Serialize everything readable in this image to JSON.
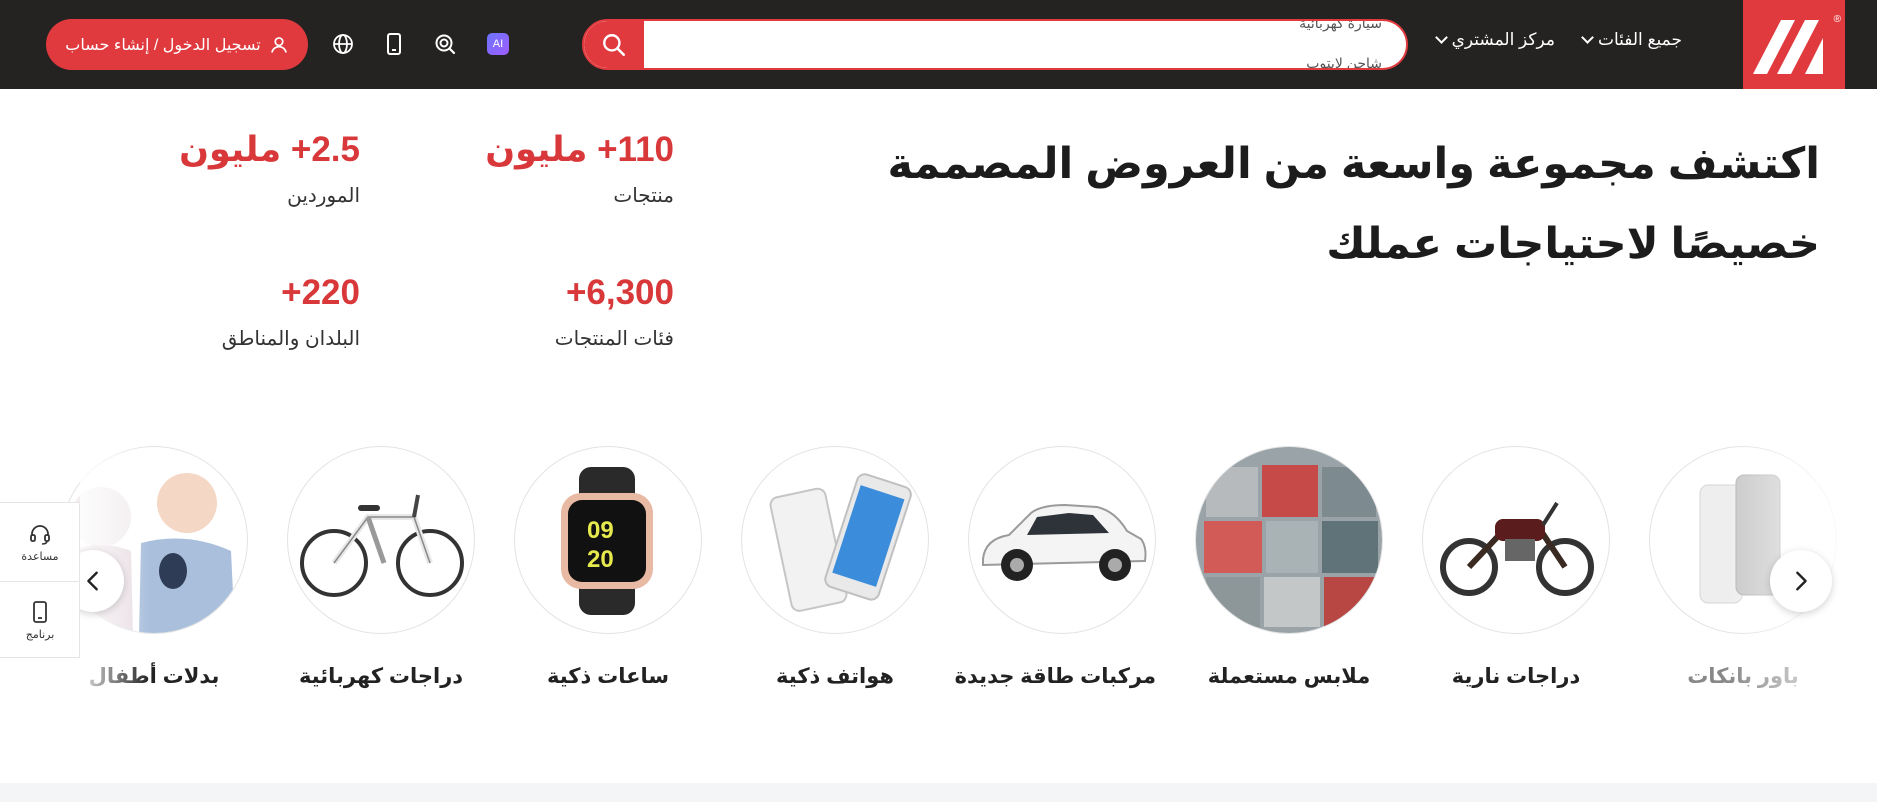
{
  "header": {
    "logo_alt": "M",
    "registered_mark": "®",
    "nav_all_categories": "جميع الفئات",
    "nav_buyer_center": "مركز المشتري",
    "search_rotating": [
      "سيارة كهربائية",
      "شاحن لابتوب"
    ],
    "login_label": "تسجيل الدخول / إنشاء حساب",
    "app_icon_text": "AI"
  },
  "hero": {
    "title": "اكتشف مجموعة واسعة من العروض المصممة خصيصًا لاحتياجات عملك",
    "stats": [
      {
        "value": "110+ مليون",
        "label": "منتجات"
      },
      {
        "value": "2.5+ مليون",
        "label": "الموردين"
      },
      {
        "value": "6,300+",
        "label": "فئات المنتجات"
      },
      {
        "value": "220+",
        "label": "البلدان والمناطق"
      }
    ]
  },
  "categories": [
    {
      "label": "باور بانكات",
      "icon": "power-bank"
    },
    {
      "label": "دراجات نارية",
      "icon": "motorcycle"
    },
    {
      "label": "ملابس مستعملة",
      "icon": "clothes-bales"
    },
    {
      "label": "مركبات طاقة جديدة",
      "icon": "electric-car"
    },
    {
      "label": "هواتف ذكية",
      "icon": "smartphone"
    },
    {
      "label": "ساعات ذكية",
      "icon": "smartwatch"
    },
    {
      "label": "دراجات كهربائية",
      "icon": "e-bike"
    },
    {
      "label": "بدلات أطفال",
      "icon": "baby-suit"
    }
  ],
  "watch_display": {
    "hours": "09",
    "minutes": "20"
  },
  "side_panel": {
    "help": "مساعدة",
    "app": "برنامج"
  },
  "colors": {
    "brand_red": "#e03a3e",
    "header_bg": "#252222",
    "stat_red": "#d9383a"
  }
}
